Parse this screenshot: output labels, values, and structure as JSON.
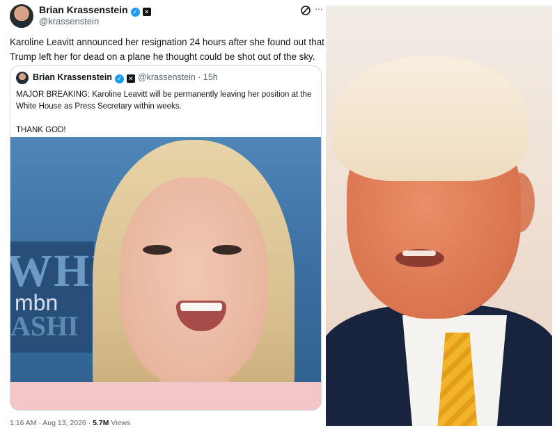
{
  "tweet": {
    "author_name": "Brian Krassenstein",
    "author_handle": "@krassenstein",
    "text_line1": "Karoline Leavitt announced her resignation 24 hours after she found out that",
    "text_line2": "Trump left her for dead on a plane he thought could be shot out of the sky.",
    "footer_time": "1:16 AM · Aug 13, 2026 ·",
    "footer_views_count": "5.7M",
    "footer_views_label": "Views"
  },
  "quote": {
    "author_name": "Brian Krassenstein",
    "handle_time": "@krassenstein · 15h",
    "line1": "MAJOR BREAKING:  Karoline Leavitt will be permanently leaving her position at the",
    "line2": "White House as Press Secretary within weeks.",
    "line3": "THANK GOD!",
    "watermark": "mbn",
    "bg_letters": "WHI",
    "bg_letters2": "ASHI"
  },
  "icons": {
    "verified": "verified-badge-icon",
    "x_logo": "x-logo-icon",
    "grok": "grok-icon",
    "more": "more-options-icon"
  },
  "colors": {
    "verified_blue": "#1d9bf0",
    "text_primary": "#0f1419",
    "text_secondary": "#536471",
    "border": "#cfd9de"
  }
}
